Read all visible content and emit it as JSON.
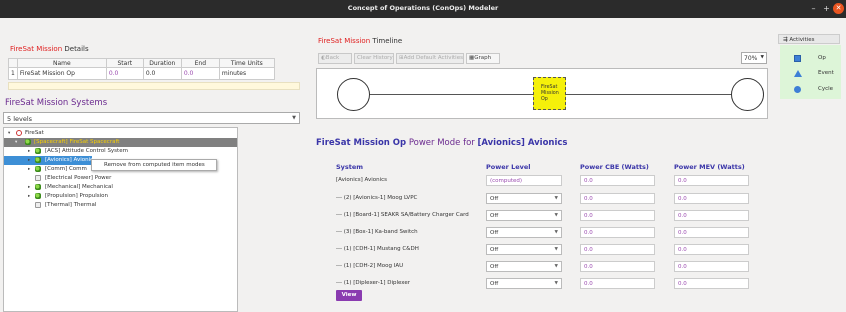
{
  "window": {
    "title": "Concept of Operations (ConOps) Modeler",
    "min_glyph": "–",
    "max_glyph": "+",
    "close_glyph": "✕"
  },
  "details": {
    "title_red": "FireSat Mission",
    "title_rest": " Details",
    "columns": [
      "Name",
      "Start",
      "Duration",
      "End",
      "Time Units"
    ],
    "row": {
      "index": "1",
      "name": "FireSat Mission Op",
      "start": "0.0",
      "duration": "0.0",
      "end": "0.0",
      "units": "minutes"
    }
  },
  "systems": {
    "title": "FireSat Mission Systems",
    "levels": "5 levels",
    "tree": [
      {
        "label": "FireSat",
        "expander": "▾",
        "icon": "root-icon"
      },
      {
        "label": "[Spacecraft] FireSat Spacecraft",
        "expander": "▾",
        "icon": "green-part-icon"
      },
      {
        "label": "[ACS] Attitude Control System",
        "expander": "▸",
        "icon": "green-part-icon"
      },
      {
        "label": "[Avionics] Avionics",
        "expander": "▸",
        "icon": "green-part-icon"
      },
      {
        "label": "[Comm] Comm",
        "expander": "▸",
        "icon": "green-part-icon"
      },
      {
        "label": "[Electrical Power] Power",
        "expander": "",
        "icon": "gray-part-icon"
      },
      {
        "label": "[Mechanical] Mechanical",
        "expander": "▸",
        "icon": "green-part-icon"
      },
      {
        "label": "[Propulsion] Propulsion",
        "expander": "▸",
        "icon": "green-part-icon"
      },
      {
        "label": "[Thermal] Thermal",
        "expander": "",
        "icon": "gray-part-icon"
      }
    ],
    "context_menu": "Remove from computed item modes"
  },
  "timeline": {
    "title_red": "FireSat Mission",
    "title_rest": " Timeline",
    "buttons": {
      "back": "◐Back",
      "clear": "Clear History",
      "add": "Add Default Activities",
      "graph": "Graph"
    },
    "zoom": "70%",
    "activity_box": [
      "FireSat",
      "Mission",
      "Op"
    ]
  },
  "power": {
    "title_a": "FireSat Mission Op",
    "title_b": " Power Mode for ",
    "title_c": "[Avionics] Avionics",
    "headers": {
      "system": "System",
      "level": "Power Level",
      "cbe": "Power CBE (Watts)",
      "mev": "Power MEV (Watts)"
    },
    "rows": [
      {
        "system": "[Avionics] Avionics",
        "level": "(computed)",
        "cbe": "0.0",
        "mev": "0.0"
      },
      {
        "system": "--- (2) [Avionics-1] Moog LVPC",
        "level": "Off",
        "cbe": "0.0",
        "mev": "0.0"
      },
      {
        "system": "--- (1) [Board-1] SEAKR SA/Battery Charger Card",
        "level": "Off",
        "cbe": "0.0",
        "mev": "0.0"
      },
      {
        "system": "--- (3) [Box-1] Ka-band Switch",
        "level": "Off",
        "cbe": "0.0",
        "mev": "0.0"
      },
      {
        "system": "--- (1) [CDH-1] Mustang C&DH",
        "level": "Off",
        "cbe": "0.0",
        "mev": "0.0"
      },
      {
        "system": "--- (1) [CDH-2] Moog IAU",
        "level": "Off",
        "cbe": "0.0",
        "mev": "0.0"
      },
      {
        "system": "--- (1) [Diplexer-1] Diplexer",
        "level": "Off",
        "cbe": "0.0",
        "mev": "0.0"
      }
    ],
    "view_button": "View"
  },
  "activities": {
    "tab": "Activities",
    "items": [
      {
        "label": "Op",
        "icon": "square-icon"
      },
      {
        "label": "Event",
        "icon": "triangle-icon"
      },
      {
        "label": "Cycle",
        "icon": "circle-icon"
      }
    ]
  },
  "colors": {
    "accent_purple": "#6b2a8f",
    "title_red": "#e02020",
    "header_blue": "#3a35a8",
    "selection_blue": "#3d8fd6",
    "activity_yellow": "#f5f00a"
  }
}
